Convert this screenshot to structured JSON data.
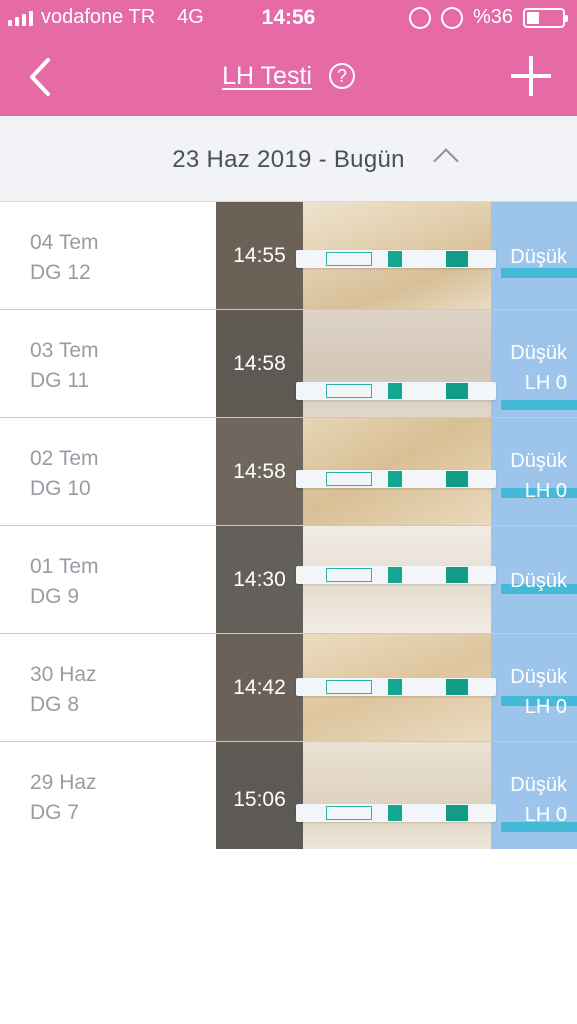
{
  "status_bar": {
    "carrier": "vodafone TR",
    "network": "4G",
    "time": "14:56",
    "battery": "%36",
    "battery_level": 0.36
  },
  "header": {
    "title": "LH Testi",
    "help_label": "?",
    "back_icon": "chevron-left-icon",
    "add_icon": "plus-icon",
    "color": "#e56aa6"
  },
  "section": {
    "label": "23 Haz 2019 - Bugün"
  },
  "tests": [
    {
      "date": "04 Tem",
      "cycle_day": "DG 12",
      "time": "14:55",
      "result": "Düşük",
      "lh": ""
    },
    {
      "date": "03 Tem",
      "cycle_day": "DG 11",
      "time": "14:58",
      "result": "Düşük",
      "lh": "LH 0"
    },
    {
      "date": "02 Tem",
      "cycle_day": "DG 10",
      "time": "14:58",
      "result": "Düşük",
      "lh": "LH 0"
    },
    {
      "date": "01 Tem",
      "cycle_day": "DG 9",
      "time": "14:30",
      "result": "Düşük",
      "lh": ""
    },
    {
      "date": "30 Haz",
      "cycle_day": "DG 8",
      "time": "14:42",
      "result": "Düşük",
      "lh": "LH 0"
    },
    {
      "date": "29 Haz",
      "cycle_day": "DG 7",
      "time": "15:06",
      "result": "Düşük",
      "lh": "LH 0"
    }
  ]
}
